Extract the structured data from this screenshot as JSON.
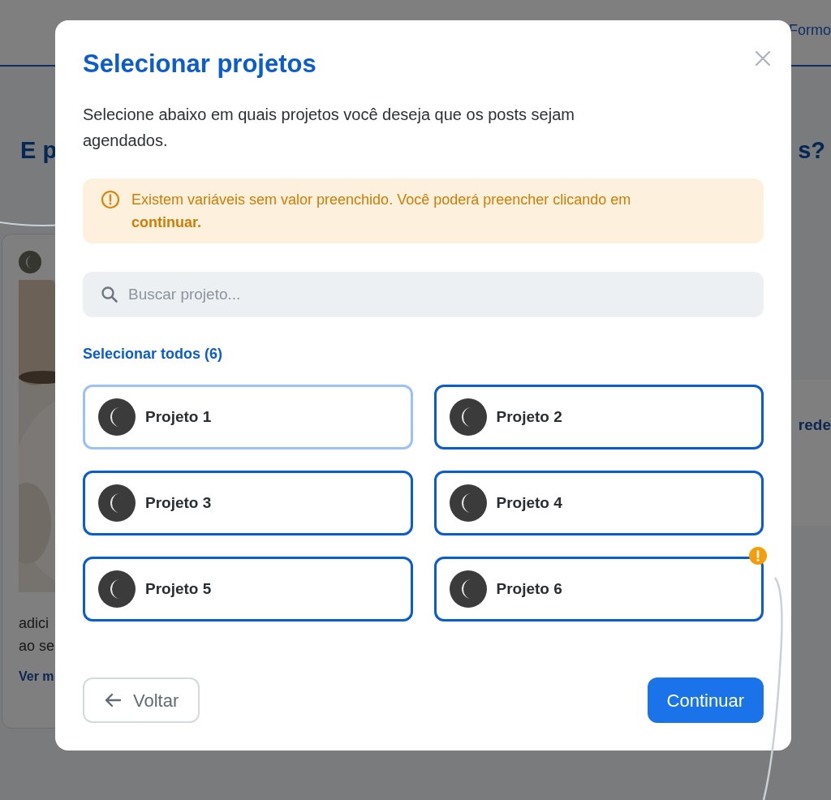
{
  "background": {
    "nav_link": "Formo",
    "heading_start": "E p",
    "heading_end": "s?",
    "card": {
      "text_lines": [
        "adici",
        "ao se"
      ],
      "link": "Ver m"
    },
    "side_text": "rede"
  },
  "dialog": {
    "title": "Selecionar projetos",
    "description": "Selecione abaixo em quais projetos você deseja que os posts sejam agendados.",
    "alert": "Existem variáveis sem valor preenchido. Você poderá preencher clicando em **continuar.**",
    "search": {
      "placeholder": "Buscar projeto..."
    },
    "select_all": "Selecionar todos (6)",
    "projects": [
      {
        "name": "Projeto 1",
        "selected": false,
        "warning": false
      },
      {
        "name": "Projeto 2",
        "selected": true,
        "warning": false
      },
      {
        "name": "Projeto 3",
        "selected": true,
        "warning": false
      },
      {
        "name": "Projeto 4",
        "selected": true,
        "warning": false
      },
      {
        "name": "Projeto 5",
        "selected": true,
        "warning": false
      },
      {
        "name": "Projeto 6",
        "selected": true,
        "warning": true
      }
    ],
    "buttons": {
      "back": "Voltar",
      "next": "Continuar"
    }
  }
}
